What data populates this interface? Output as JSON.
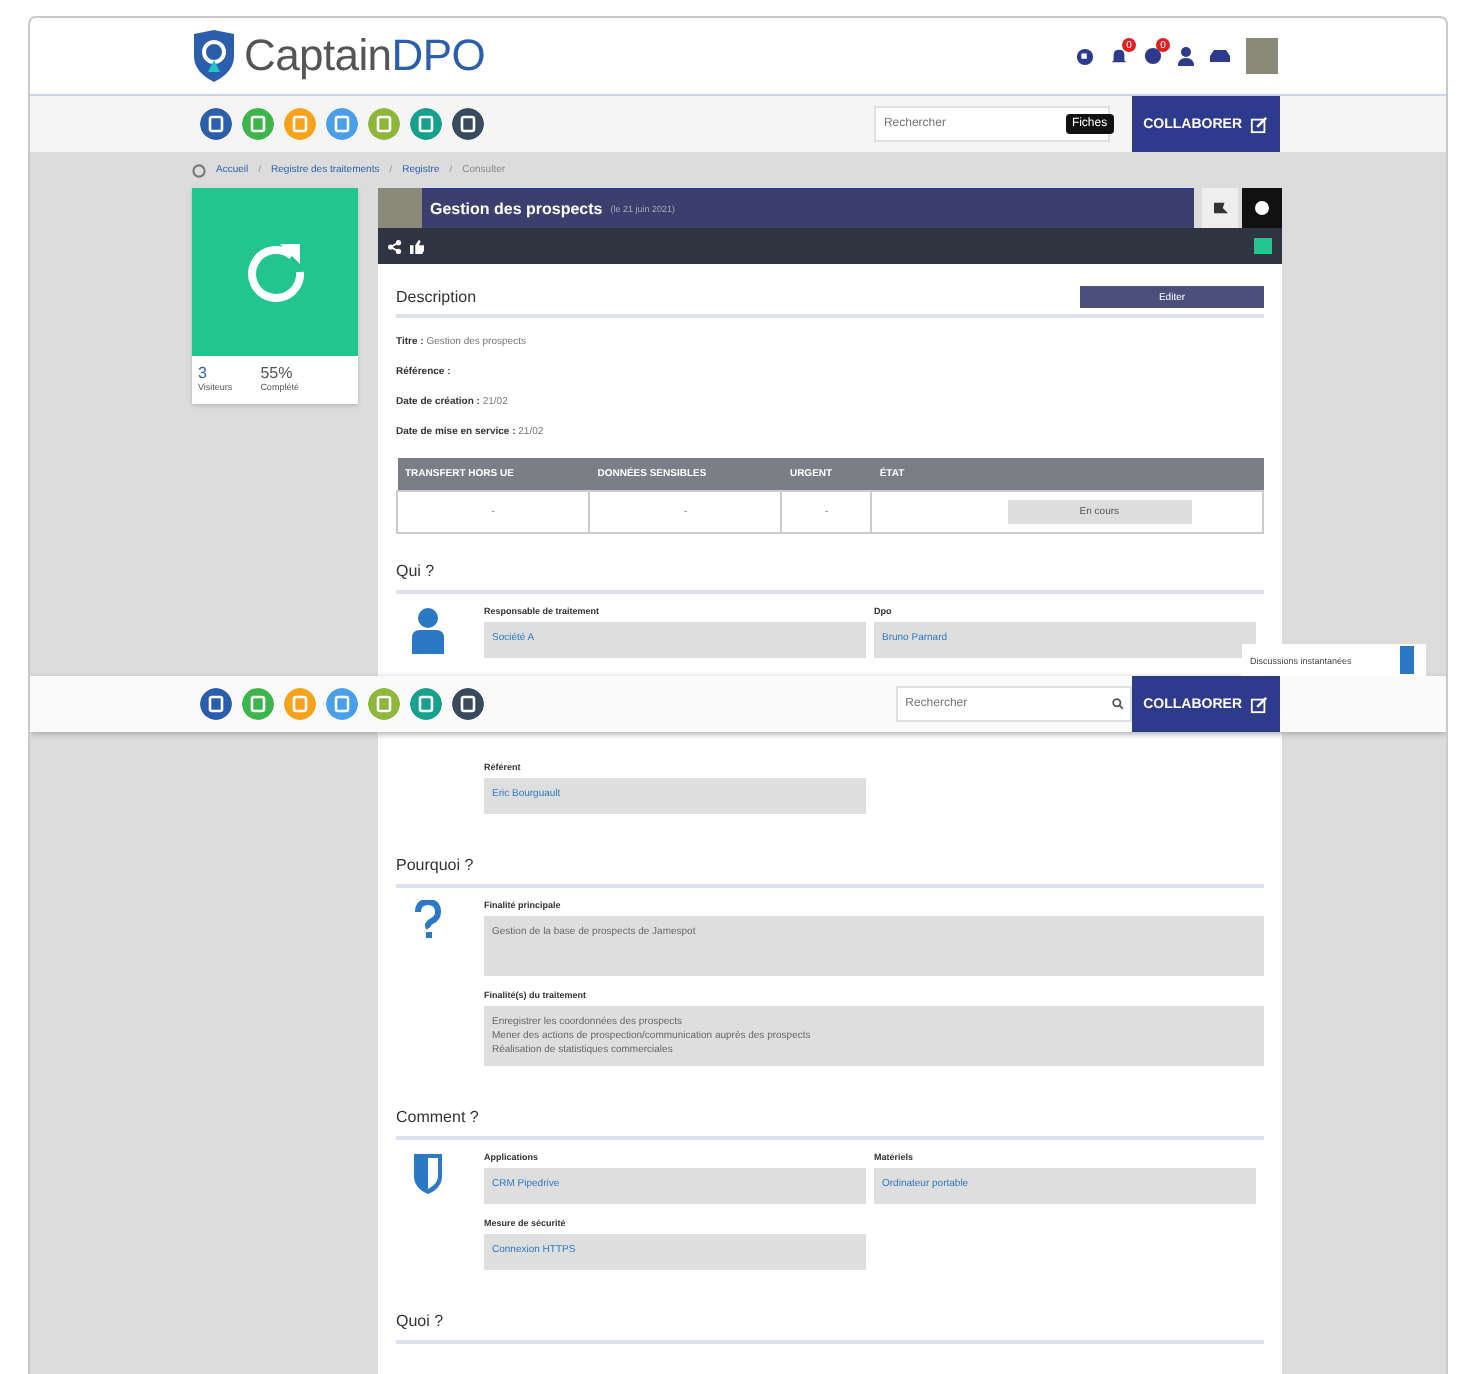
{
  "header": {
    "logo": {
      "name": "Captain",
      "accent": "DPO"
    },
    "badges": [
      "0",
      "0"
    ]
  },
  "toolbar": {
    "modules": [
      {
        "color": "#2b5fad"
      },
      {
        "color": "#3db54a"
      },
      {
        "color": "#f7a21b"
      },
      {
        "color": "#4a9fe8"
      },
      {
        "color": "#8db63c"
      },
      {
        "color": "#17a08e"
      },
      {
        "color": "#3a4a5e"
      }
    ],
    "search": {
      "placeholder": "Rechercher"
    },
    "tooltip": "Fiches",
    "button": "COLLABORER"
  },
  "breadcrumb": {
    "separator": "/",
    "items": [
      "Accueil",
      "Registre des traitements",
      "Registre",
      "Consulter"
    ]
  },
  "summary_card": {
    "stats": [
      {
        "value": "3",
        "label": "Visiteurs"
      },
      {
        "value": "55%",
        "label": "Complété"
      }
    ]
  },
  "record": {
    "title": "Gestion des prospects",
    "date": "(le 21 juin 2021)"
  },
  "description": {
    "heading": "Description",
    "button": "Editer",
    "fields": [
      {
        "label": "Titre :",
        "value": "Gestion des prospects"
      },
      {
        "label": "Référence :"
      },
      {
        "label": "Date de création :",
        "value": "21/02"
      },
      {
        "label": "Date de mise en service :",
        "value": "21/02"
      }
    ],
    "table": {
      "columns": [
        "TRANSFERT HORS UE",
        "DONNÉES SENSIBLES",
        "URGENT",
        "ÉTAT"
      ],
      "cells": [
        "-",
        "-",
        "-"
      ],
      "status": "En cours"
    }
  },
  "sections": [
    {
      "heading": "Qui ?",
      "kind": "person",
      "rows": [
        [
          {
            "label": "Responsable de traitement",
            "value": "Société A"
          },
          {
            "label": "Dpo",
            "value": "Bruno Parnard"
          }
        ],
        [],
        [
          {
            "label": "Référent",
            "value": "Eric Bourguault"
          }
        ]
      ]
    },
    {
      "heading": "Pourquoi ?",
      "kind": "question",
      "rows": [
        [
          {
            "label": "Finalité principale",
            "value": "Gestion de la base de prospects de Jamespot",
            "tall": true
          }
        ],
        [
          {
            "label": "Finalité(s) du traitement",
            "value": "Enregistrer les coordonnées des prospects\nMener des actions de prospection/communication auprès des prospects\nRéalisation de statistiques commerciales",
            "tall": true
          }
        ]
      ]
    },
    {
      "heading": "Comment ?",
      "kind": "shield",
      "rows": [
        [
          {
            "label": "Applications",
            "value": "CRM Pipedrive"
          },
          {
            "label": "Matériels",
            "value": "Ordinateur portable"
          }
        ],
        [
          {
            "label": "Mesure de sécurité",
            "value": "Connexion HTTPS"
          }
        ]
      ]
    },
    {
      "heading": "Quoi ?"
    }
  ],
  "sticky_toolbar": {
    "search": {
      "placeholder": "Rechercher"
    },
    "button": "COLLABORER"
  },
  "chat_tab": {
    "label": "Discussions instantanées"
  }
}
